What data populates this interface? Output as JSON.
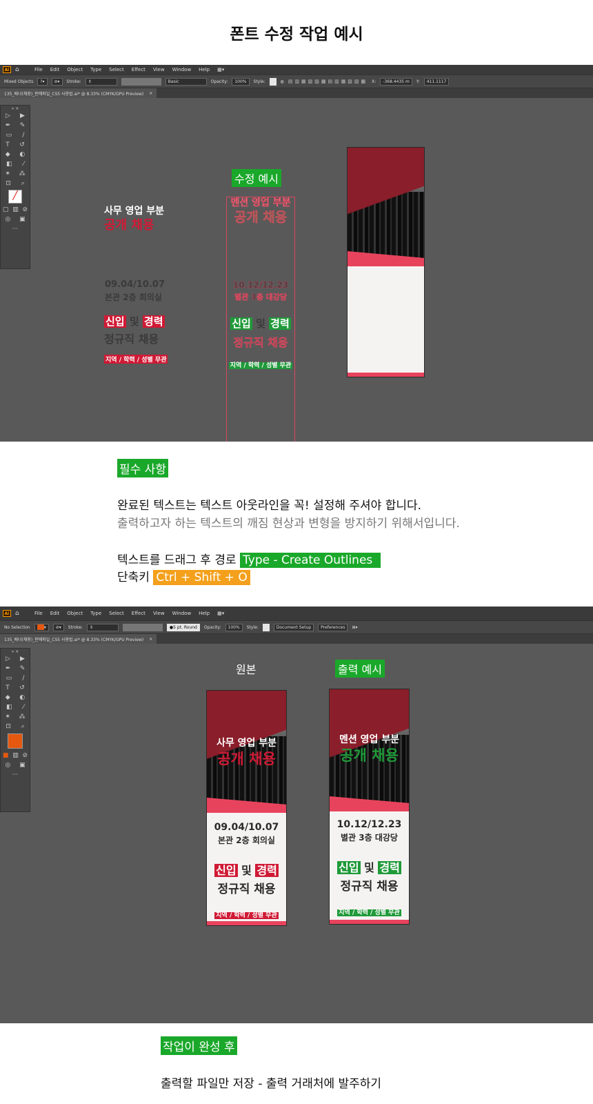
{
  "page_title": "폰트 수정 작업 예시",
  "app": {
    "menu": [
      "File",
      "Edit",
      "Object",
      "Type",
      "Select",
      "Effect",
      "View",
      "Window",
      "Help"
    ],
    "logo": "Ai"
  },
  "shot1": {
    "ctrl": {
      "selection": "Mixed Objects",
      "stroke_label": "Stroke:",
      "stroke_style": "Basic",
      "opacity_label": "Opacity:",
      "opacity": "100%",
      "style_label": "Style:",
      "x_label": "X:",
      "x_value": "-368.4435 m",
      "y_label": "Y:",
      "y_value": "411.1117"
    },
    "tab": "135_배너(채용)_판매파일_CS5 사용법.ai* @ 8.33% (CMYK/GPU Preview)",
    "left": {
      "line1": "사무 영업 부분",
      "line2": "공개 채용",
      "date": "09.04/10.07",
      "place": "본관 2층 회의실",
      "w1": "신입",
      "w2": "및",
      "w3": "경력",
      "line4": "정규직 채용",
      "footer": "지역 / 학력 / 성별 무관"
    },
    "edit_label": "수정 예시",
    "mid": {
      "line1": "멘션 영업 부분",
      "line2": "공개 채용",
      "date": "10.12/12.23",
      "place": "별관 3층 대강당",
      "w1": "신입",
      "w2": "및",
      "w3": "경력",
      "line4": "정규직 채용",
      "footer": "지역 / 학력 / 성별 무관"
    }
  },
  "instructions": {
    "heading": "필수 사항",
    "line1": "완료된 텍스트는 텍스트 아웃라인을 꼭! 설정해 주셔야 합니다.",
    "line2": "출력하고자 하는 텍스트의 깨짐 현상과 변형을 방지하기 위해서입니다.",
    "line3_prefix": "텍스트를 드래그 후 경로",
    "line3_cmd": "Type - Create Outlines",
    "line4_prefix": "단축키",
    "line4_key": "Ctrl + Shift + O"
  },
  "shot2": {
    "ctrl": {
      "selection": "No Selection",
      "stroke_label": "Stroke:",
      "brush": "5 pt. Round",
      "opacity_label": "Opacity:",
      "opacity": "100%",
      "style_label": "Style:",
      "doc_setup": "Document Setup",
      "prefs": "Preferences"
    },
    "tab": "135_배너(채용)_판매파일_CS5 사용법.ai* @ 8.33% (CMYK/GPU Preview)",
    "original_label": "원본",
    "output_label": "출력 예시",
    "original": {
      "line1": "사무 영업 부분",
      "line2": "공개 채용",
      "date": "09.04/10.07",
      "place": "본관 2층 회의실",
      "w1": "신입",
      "w2": "및",
      "w3": "경력",
      "line4": "정규직 채용",
      "footer": "지역 / 학력 / 성별 무관"
    },
    "output": {
      "line1": "멘션 영업 부분",
      "line2": "공개 채용",
      "date": "10.12/12.23",
      "place": "별관 3층 대강당",
      "w1": "신입",
      "w2": "및",
      "w3": "경력",
      "line4": "정규직 채용",
      "footer": "지역 / 학력 / 성별 무관"
    }
  },
  "after": {
    "heading": "작업이 완성 후",
    "line": "출력할 파일만 저장 - 출력 거래처에 발주하기"
  },
  "colors": {
    "accent_green": "#1aa82a",
    "accent_orange": "#f4a01c",
    "banner_red": "#d01a35",
    "canvas_gray": "#595959"
  }
}
